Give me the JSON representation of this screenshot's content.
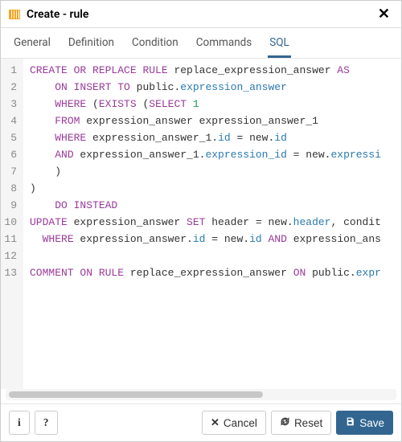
{
  "dialog": {
    "title": "Create - rule"
  },
  "tabs": {
    "items": [
      "General",
      "Definition",
      "Condition",
      "Commands",
      "SQL"
    ],
    "active": 4
  },
  "code": {
    "lines": [
      {
        "n": 1,
        "segs": [
          {
            "t": "CREATE OR REPLACE",
            "c": "kw"
          },
          {
            "t": " "
          },
          {
            "t": "RULE",
            "c": "kw"
          },
          {
            "t": " replace_expression_answer "
          },
          {
            "t": "AS",
            "c": "kw"
          }
        ]
      },
      {
        "n": 2,
        "segs": [
          {
            "t": "    "
          },
          {
            "t": "ON INSERT TO",
            "c": "kw"
          },
          {
            "t": " public."
          },
          {
            "t": "expression_answer",
            "c": "id"
          }
        ]
      },
      {
        "n": 3,
        "segs": [
          {
            "t": "    "
          },
          {
            "t": "WHERE",
            "c": "kw"
          },
          {
            "t": " ("
          },
          {
            "t": "EXISTS",
            "c": "kw"
          },
          {
            "t": " ("
          },
          {
            "t": "SELECT",
            "c": "kw"
          },
          {
            "t": " "
          },
          {
            "t": "1",
            "c": "num"
          }
        ]
      },
      {
        "n": 4,
        "segs": [
          {
            "t": "    "
          },
          {
            "t": "FROM",
            "c": "kw"
          },
          {
            "t": " expression_answer expression_answer_1"
          }
        ]
      },
      {
        "n": 5,
        "segs": [
          {
            "t": "    "
          },
          {
            "t": "WHERE",
            "c": "kw"
          },
          {
            "t": " expression_answer_1."
          },
          {
            "t": "id",
            "c": "id"
          },
          {
            "t": " = new."
          },
          {
            "t": "id",
            "c": "id"
          }
        ]
      },
      {
        "n": 6,
        "segs": [
          {
            "t": "    "
          },
          {
            "t": "AND",
            "c": "kw"
          },
          {
            "t": " expression_answer_1."
          },
          {
            "t": "expression_id",
            "c": "id"
          },
          {
            "t": " = new."
          },
          {
            "t": "expressi",
            "c": "id"
          }
        ]
      },
      {
        "n": 7,
        "segs": [
          {
            "t": "    )"
          }
        ]
      },
      {
        "n": 8,
        "segs": [
          {
            "t": ")"
          }
        ]
      },
      {
        "n": 9,
        "segs": [
          {
            "t": "    "
          },
          {
            "t": "DO INSTEAD",
            "c": "kw"
          }
        ]
      },
      {
        "n": 10,
        "segs": [
          {
            "t": "UPDATE",
            "c": "kw"
          },
          {
            "t": " expression_answer "
          },
          {
            "t": "SET",
            "c": "kw"
          },
          {
            "t": " header = new."
          },
          {
            "t": "header",
            "c": "id"
          },
          {
            "t": ", condit"
          }
        ]
      },
      {
        "n": 11,
        "segs": [
          {
            "t": "  "
          },
          {
            "t": "WHERE",
            "c": "kw"
          },
          {
            "t": " expression_answer."
          },
          {
            "t": "id",
            "c": "id"
          },
          {
            "t": " = new."
          },
          {
            "t": "id",
            "c": "id"
          },
          {
            "t": " "
          },
          {
            "t": "AND",
            "c": "kw"
          },
          {
            "t": " expression_ans"
          }
        ]
      },
      {
        "n": 12,
        "segs": [
          {
            "t": ""
          }
        ]
      },
      {
        "n": 13,
        "segs": [
          {
            "t": "COMMENT ON",
            "c": "kw"
          },
          {
            "t": " "
          },
          {
            "t": "RULE",
            "c": "kw"
          },
          {
            "t": " replace_expression_answer "
          },
          {
            "t": "ON",
            "c": "kw"
          },
          {
            "t": " public."
          },
          {
            "t": "expr",
            "c": "id"
          }
        ]
      }
    ]
  },
  "footer": {
    "info": "i",
    "help": "?",
    "cancel": "Cancel",
    "reset": "Reset",
    "save": "Save"
  }
}
